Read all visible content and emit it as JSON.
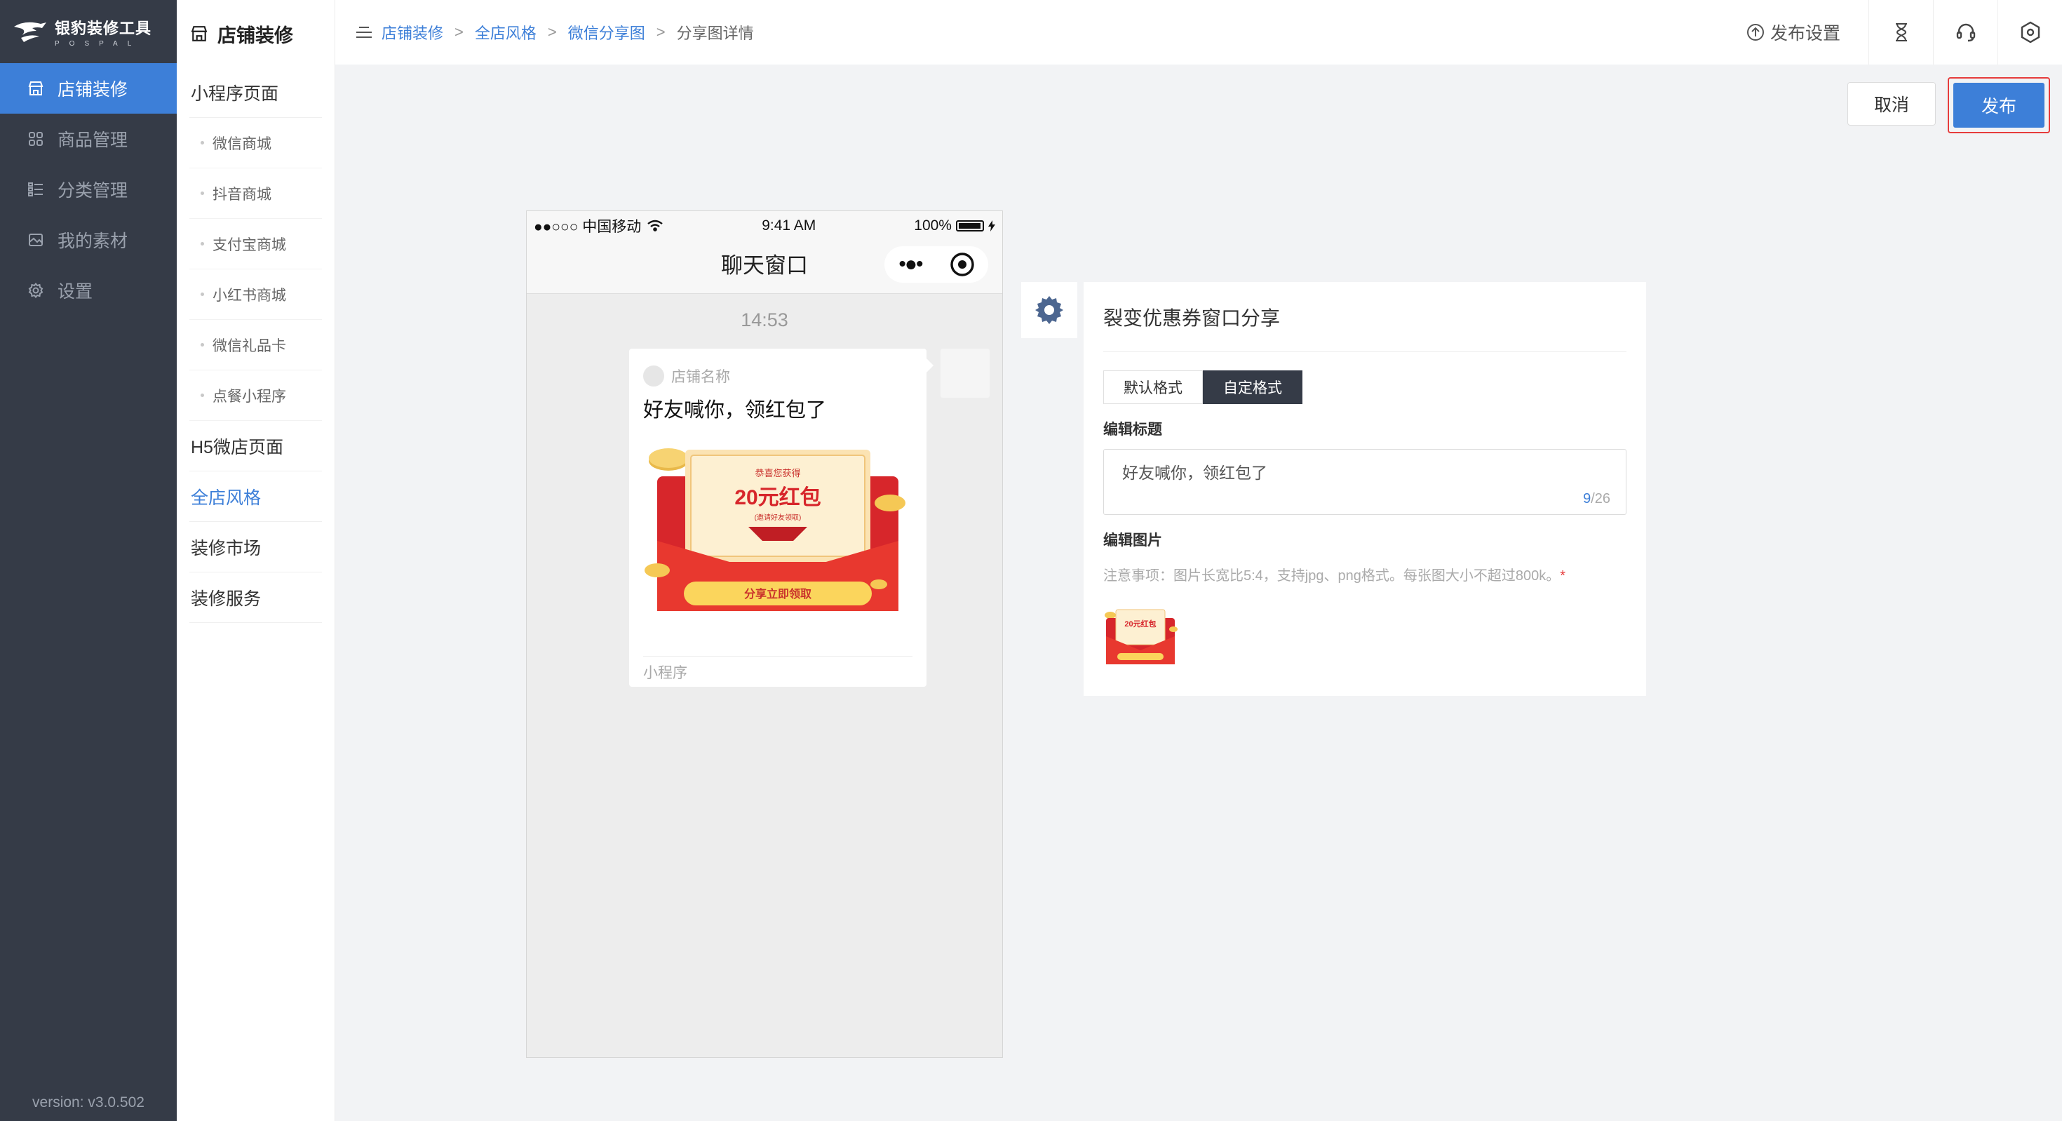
{
  "app": {
    "logo_cn": "银豹装修工具",
    "logo_en": "POSPAL",
    "version": "version: v3.0.502"
  },
  "nav": {
    "items": [
      {
        "label": "店铺装修",
        "icon": "store-icon",
        "active": true
      },
      {
        "label": "商品管理",
        "icon": "grid-icon",
        "active": false
      },
      {
        "label": "分类管理",
        "icon": "list-icon",
        "active": false
      },
      {
        "label": "我的素材",
        "icon": "image-icon",
        "active": false
      },
      {
        "label": "设置",
        "icon": "gear-icon",
        "active": false
      }
    ]
  },
  "side": {
    "title": "店铺装修",
    "mini_program": "小程序页面",
    "sub_items": [
      "微信商城",
      "抖音商城",
      "支付宝商城",
      "小红书商城",
      "微信礼品卡",
      "点餐小程序"
    ],
    "h5": "H5微店页面",
    "style": "全店风格",
    "market": "装修市场",
    "service": "装修服务"
  },
  "breadcrumb": {
    "items": [
      "店铺装修",
      "全店风格",
      "微信分享图"
    ],
    "current": "分享图详情",
    "sep": ">"
  },
  "top": {
    "publish_settings": "发布设置",
    "cancel": "取消",
    "publish": "发布"
  },
  "phone": {
    "carrier": "●●○○○ 中国移动",
    "time": "9:41 AM",
    "battery": "100%",
    "title": "聊天窗口",
    "capsule_dots": "•●•",
    "stamp": "14:53",
    "shop_name": "店铺名称",
    "card_title": "好友喊你，领红包了",
    "card_footer": "小程序",
    "promo_top": "恭喜您获得",
    "promo_amount": "20元红包",
    "promo_sub": "(邀请好友领取)",
    "promo_button": "分享立即领取"
  },
  "panel": {
    "title": "裂变优惠券窗口分享",
    "tabs": [
      "默认格式",
      "自定格式"
    ],
    "active_tab": 1,
    "edit_title_label": "编辑标题",
    "title_value": "好友喊你，领红包了",
    "count": "9",
    "max": "/26",
    "edit_image_label": "编辑图片",
    "note": "注意事项：图片长宽比5:4，支持jpg、png格式。每张图大小不超过800k。",
    "note_star": "*",
    "thumb_amount": "20元红包"
  },
  "colors": {
    "nav_bg": "#353b47",
    "accent": "#3d7fd8",
    "highlight": "#e63c3c",
    "promo_red": "#e8382f"
  }
}
